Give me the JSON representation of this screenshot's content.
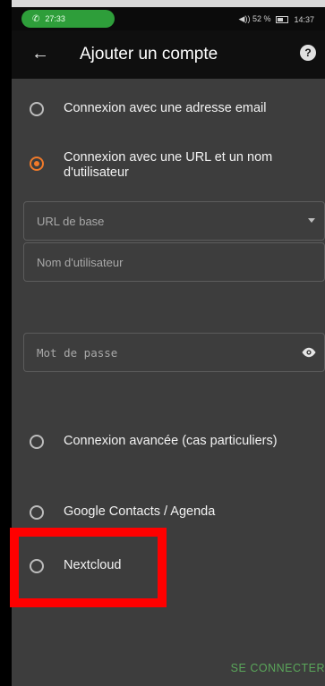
{
  "status_bar": {
    "call_time": "27:33",
    "battery_text": "◀)) 52 %",
    "clock": "14:37"
  },
  "app_bar": {
    "title": "Ajouter un compte",
    "back_icon": "←",
    "help_icon": "?"
  },
  "login_options": [
    {
      "label": "Connexion avec une adresse email",
      "selected": false
    },
    {
      "label": "Connexion avec une URL et un nom d'utilisateur",
      "selected": true
    },
    {
      "label": "Connexion avancée (cas particuliers)",
      "selected": false
    },
    {
      "label": "Google Contacts / Agenda",
      "selected": false
    },
    {
      "label": "Nextcloud",
      "selected": false
    }
  ],
  "form": {
    "base_url_placeholder": "URL de base",
    "username_placeholder": "Nom d'utilisateur",
    "password_placeholder": "Mot de passe"
  },
  "actions": {
    "connect_label": "SE CONNECTER"
  },
  "colors": {
    "accent": "#f07a2a",
    "connect_text": "#5aa65a",
    "highlight": "#ff0000",
    "call_pill": "#2e9e3a"
  }
}
